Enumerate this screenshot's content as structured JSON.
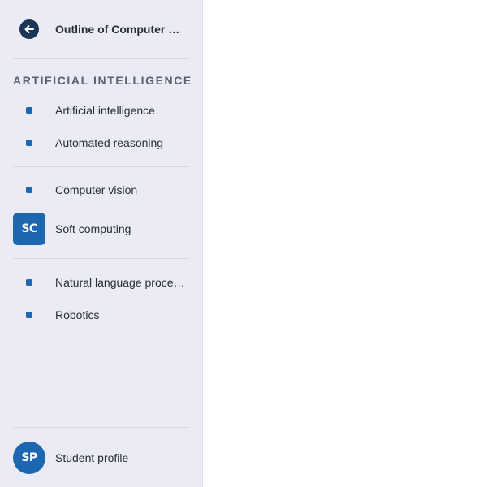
{
  "header": {
    "back_icon": "arrow-left-icon",
    "title": "Outline of Computer Science"
  },
  "section": {
    "title": "ARTIFICIAL INTELLIGENCE"
  },
  "nav": {
    "items": [
      {
        "label": "Artificial intelligence",
        "marker": "bullet"
      },
      {
        "label": "Automated reasoning",
        "marker": "bullet"
      },
      {
        "label": "Computer vision",
        "marker": "bullet"
      },
      {
        "label": "Soft computing",
        "marker": "badge",
        "badge_text": "SC"
      },
      {
        "label": "Natural language processing",
        "marker": "bullet"
      },
      {
        "label": "Robotics",
        "marker": "bullet"
      }
    ]
  },
  "footer": {
    "avatar_text": "SP",
    "label": "Student profile"
  },
  "colors": {
    "sidebar_bg": "#eaebf4",
    "accent": "#1d67b0",
    "back_button": "#1a3556"
  }
}
